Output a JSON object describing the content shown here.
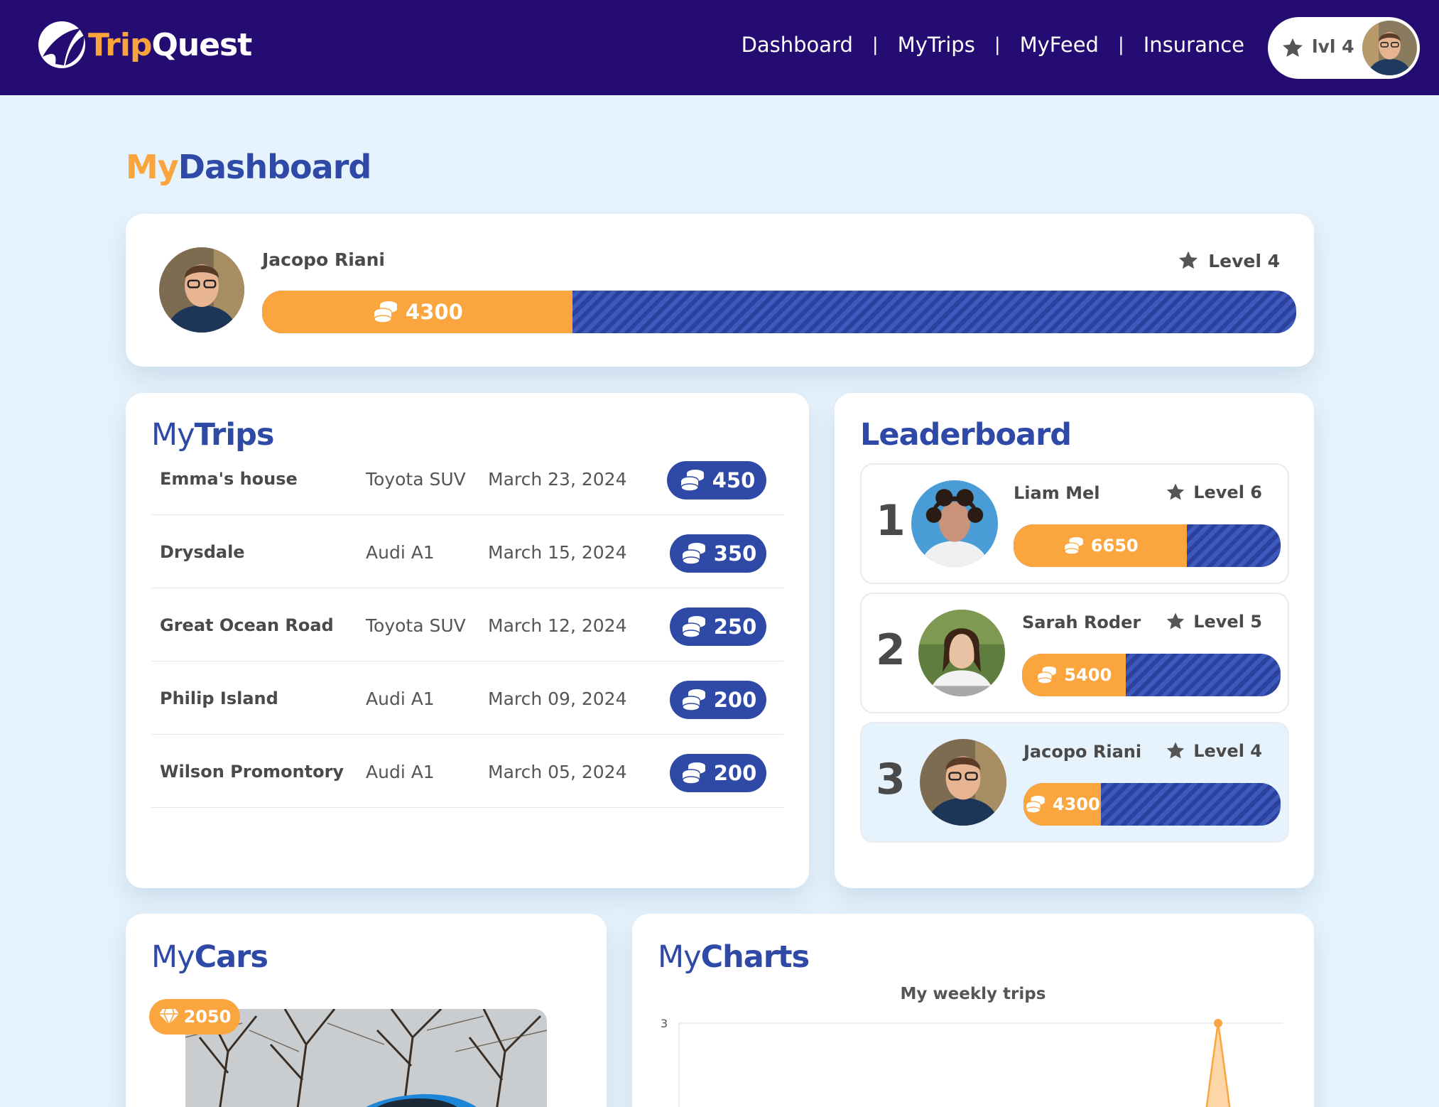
{
  "app": {
    "logo_part1": "Trip",
    "logo_part2": "Quest"
  },
  "nav": {
    "links": [
      "Dashboard",
      "MyTrips",
      "MyFeed",
      "Insurance"
    ],
    "separator": "|",
    "level_label": "lvl 4"
  },
  "page_title": {
    "part1": "My",
    "part2": "Dashboard"
  },
  "profile": {
    "name": "Jacopo Riani",
    "level_label": "Level 4",
    "coins": "4300",
    "progress": 0.3
  },
  "trips": {
    "title_part1": "My",
    "title_part2": "Trips",
    "rows": [
      {
        "name": "Emma's house",
        "car": "Toyota SUV",
        "date": "March 23, 2024",
        "coins": "450"
      },
      {
        "name": "Drysdale",
        "car": "Audi A1",
        "date": "March 15, 2024",
        "coins": "350"
      },
      {
        "name": "Great Ocean Road",
        "car": "Toyota SUV",
        "date": "March 12, 2024",
        "coins": "250"
      },
      {
        "name": "Philip Island",
        "car": "Audi A1",
        "date": "March 09, 2024",
        "coins": "200"
      },
      {
        "name": "Wilson Promontory",
        "car": "Audi A1",
        "date": "March 05, 2024",
        "coins": "200"
      }
    ]
  },
  "leaderboard": {
    "title": "Leaderboard",
    "entries": [
      {
        "rank": "1",
        "name": "Liam Mel",
        "level_label": "Level 6",
        "coins": "6650",
        "progress": 0.65
      },
      {
        "rank": "2",
        "name": "Sarah Roder",
        "level_label": "Level 5",
        "coins": "5400",
        "progress": 0.4
      },
      {
        "rank": "3",
        "name": "Jacopo Riani",
        "level_label": "Level 4",
        "coins": "4300",
        "progress": 0.3
      }
    ]
  },
  "cars": {
    "title_part1": "My",
    "title_part2": "Cars",
    "badge_value": "2050"
  },
  "charts": {
    "title_part1": "My",
    "title_part2": "Charts"
  },
  "chart_data": {
    "type": "area",
    "title": "My weekly trips",
    "xlabel": "",
    "ylabel": "",
    "y_tick_labels": [
      "3"
    ],
    "ylim": [
      0,
      3
    ],
    "series": [
      {
        "values": [
          3
        ]
      }
    ],
    "color": "#fba53f",
    "grid": true
  },
  "colors": {
    "navy": "#250c72",
    "brand_blue": "#2f49a6",
    "orange": "#fba53f",
    "background": "#e6f3fd"
  },
  "icons": {
    "coins": "coins-icon",
    "star": "star-icon",
    "diamond": "diamond-icon"
  }
}
